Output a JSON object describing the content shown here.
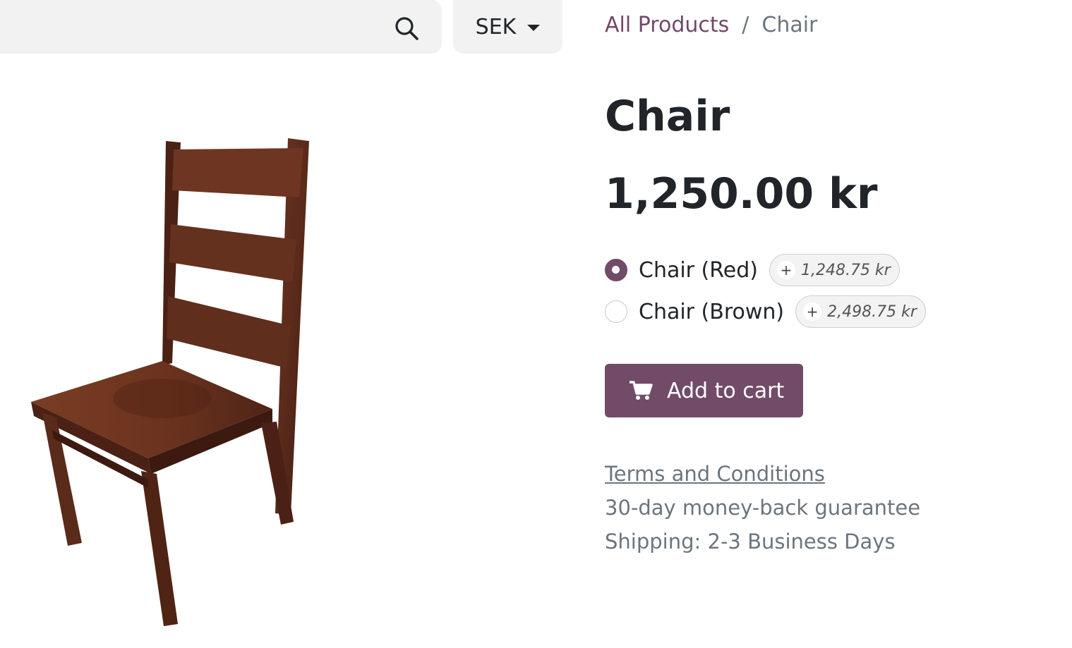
{
  "search": {
    "value": "",
    "placeholder": "",
    "icon": "search-icon"
  },
  "currency": {
    "selected": "SEK"
  },
  "breadcrumb": {
    "parent": "All Products",
    "separator": "/",
    "current": "Chair"
  },
  "product": {
    "title": "Chair",
    "price": "1,250.00 kr",
    "variants": [
      {
        "label": "Chair (Red)",
        "extra_sign": "+",
        "extra_price": "1,248.75 kr",
        "selected": true
      },
      {
        "label": "Chair (Brown)",
        "extra_sign": "+",
        "extra_price": "2,498.75 kr",
        "selected": false
      }
    ],
    "add_to_cart_label": "Add to cart",
    "terms_label": "Terms and Conditions",
    "guarantee": "30-day money-back guarantee",
    "shipping": "Shipping: 2-3 Business Days"
  },
  "colors": {
    "brand": "#714b67",
    "text": "#212529",
    "muted": "#6c757d",
    "input_bg": "#f2f2f2"
  }
}
